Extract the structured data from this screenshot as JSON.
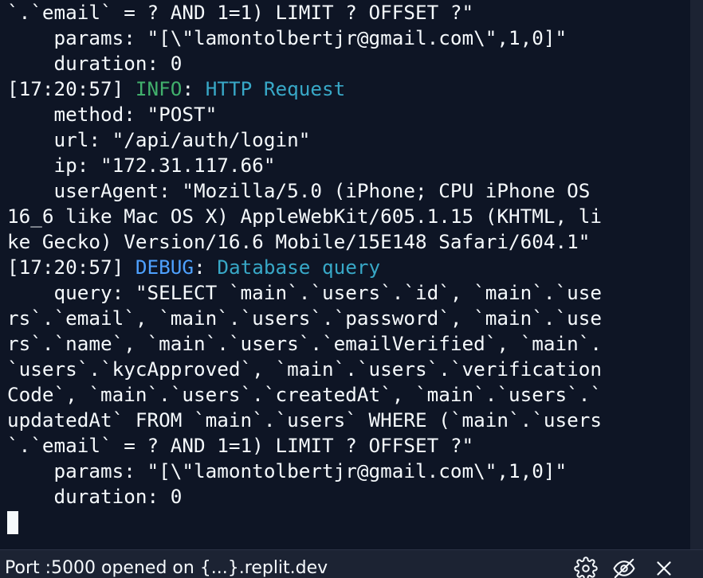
{
  "terminal": {
    "lines": [
      {
        "parts": [
          {
            "t": "`.`email` = ? AND 1=1) LIMIT ? OFFSET ?\"",
            "c": ""
          }
        ]
      },
      {
        "parts": [
          {
            "t": "    params: \"[\\\"lamontolbertjr@gmail.com\\\",1,0]\"",
            "c": ""
          }
        ]
      },
      {
        "parts": [
          {
            "t": "    duration: 0",
            "c": ""
          }
        ]
      },
      {
        "parts": [
          {
            "t": "[17:20:57] ",
            "c": ""
          },
          {
            "t": "INFO",
            "c": "c-info"
          },
          {
            "t": ": ",
            "c": ""
          },
          {
            "t": "HTTP Request",
            "c": "c-msg"
          }
        ]
      },
      {
        "parts": [
          {
            "t": "    method: \"POST\"",
            "c": ""
          }
        ]
      },
      {
        "parts": [
          {
            "t": "    url: \"/api/auth/login\"",
            "c": ""
          }
        ]
      },
      {
        "parts": [
          {
            "t": "    ip: \"172.31.117.66\"",
            "c": ""
          }
        ]
      },
      {
        "parts": [
          {
            "t": "    userAgent: \"Mozilla/5.0 (iPhone; CPU iPhone OS",
            "c": ""
          }
        ]
      },
      {
        "parts": [
          {
            "t": "16_6 like Mac OS X) AppleWebKit/605.1.15 (KHTML, li",
            "c": ""
          }
        ]
      },
      {
        "parts": [
          {
            "t": "ke Gecko) Version/16.6 Mobile/15E148 Safari/604.1\"",
            "c": ""
          }
        ]
      },
      {
        "parts": [
          {
            "t": "[17:20:57] ",
            "c": ""
          },
          {
            "t": "DEBUG",
            "c": "c-debug"
          },
          {
            "t": ": ",
            "c": ""
          },
          {
            "t": "Database query",
            "c": "c-msg"
          }
        ]
      },
      {
        "parts": [
          {
            "t": "    query: \"SELECT `main`.`users`.`id`, `main`.`use",
            "c": ""
          }
        ]
      },
      {
        "parts": [
          {
            "t": "rs`.`email`, `main`.`users`.`password`, `main`.`use",
            "c": ""
          }
        ]
      },
      {
        "parts": [
          {
            "t": "rs`.`name`, `main`.`users`.`emailVerified`, `main`.",
            "c": ""
          }
        ]
      },
      {
        "parts": [
          {
            "t": "`users`.`kycApproved`, `main`.`users`.`verification",
            "c": ""
          }
        ]
      },
      {
        "parts": [
          {
            "t": "Code`, `main`.`users`.`createdAt`, `main`.`users`.`",
            "c": ""
          }
        ]
      },
      {
        "parts": [
          {
            "t": "updatedAt` FROM `main`.`users` WHERE (`main`.`users",
            "c": ""
          }
        ]
      },
      {
        "parts": [
          {
            "t": "`.`email` = ? AND 1=1) LIMIT ? OFFSET ?\"",
            "c": ""
          }
        ]
      },
      {
        "parts": [
          {
            "t": "    params: \"[\\\"lamontolbertjr@gmail.com\\\",1,0]\"",
            "c": ""
          }
        ]
      },
      {
        "parts": [
          {
            "t": "    duration: 0",
            "c": ""
          }
        ]
      }
    ]
  },
  "status_bar": {
    "text": "Port :5000 opened on {...}.replit.dev",
    "icons": [
      "gear-icon",
      "eye-off-icon",
      "close-icon"
    ]
  },
  "colors": {
    "terminal_bg": "#0e1525",
    "chrome_bg": "#1c2333",
    "text": "#f5f9fc",
    "info": "#41b06c",
    "debug": "#4ea1ff",
    "message": "#38a8c7"
  }
}
